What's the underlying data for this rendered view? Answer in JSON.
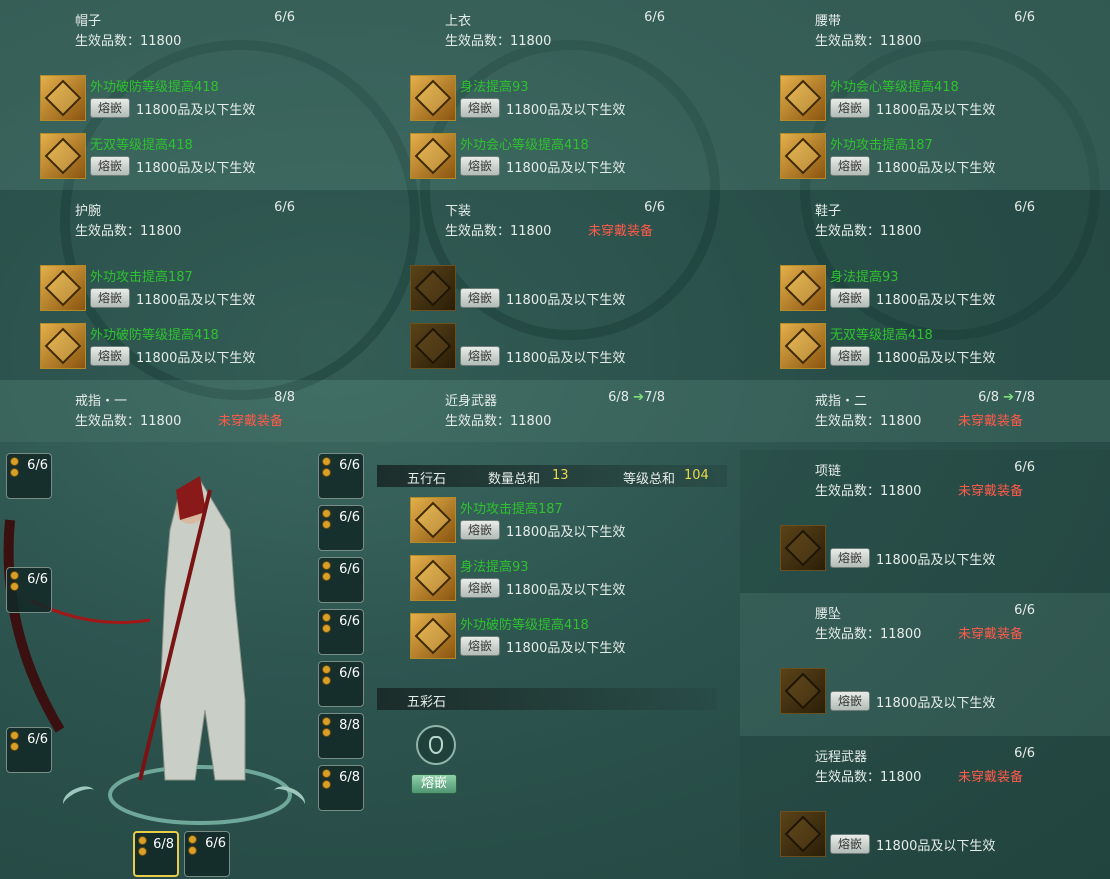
{
  "inlay_label": "熔嵌",
  "quality_label": "生效品数：",
  "unworn_label": "未穿戴装备",
  "slots": [
    {
      "name": "帽子",
      "count": "6/6",
      "quality": "11800",
      "gems": [
        {
          "attr": "外功破防等级提高418",
          "desc": "11800品及以下生效"
        },
        {
          "attr": "无双等级提高418",
          "desc": "11800品及以下生效"
        }
      ]
    },
    {
      "name": "上衣",
      "count": "6/6",
      "quality": "11800",
      "gems": [
        {
          "attr": "身法提高93",
          "desc": "11800品及以下生效"
        },
        {
          "attr": "外功会心等级提高418",
          "desc": "11800品及以下生效"
        }
      ]
    },
    {
      "name": "腰带",
      "count": "6/6",
      "quality": "11800",
      "gems": [
        {
          "attr": "外功会心等级提高418",
          "desc": "11800品及以下生效"
        },
        {
          "attr": "外功攻击提高187",
          "desc": "11800品及以下生效"
        }
      ]
    },
    {
      "name": "护腕",
      "count": "6/6",
      "quality": "11800",
      "gems": [
        {
          "attr": "外功攻击提高187",
          "desc": "11800品及以下生效"
        },
        {
          "attr": "外功破防等级提高418",
          "desc": "11800品及以下生效"
        }
      ]
    },
    {
      "name": "下装",
      "count": "6/6",
      "quality": "11800",
      "unworn": true,
      "gems": [
        {
          "attr": "",
          "desc": "11800品及以下生效"
        },
        {
          "attr": "",
          "desc": "11800品及以下生效"
        }
      ]
    },
    {
      "name": "鞋子",
      "count": "6/6",
      "quality": "11800",
      "gems": [
        {
          "attr": "身法提高93",
          "desc": "11800品及以下生效"
        },
        {
          "attr": "无双等级提高418",
          "desc": "11800品及以下生效"
        }
      ]
    },
    {
      "name": "戒指・一",
      "count": "8/8",
      "quality": "11800",
      "unworn": true
    },
    {
      "name": "近身武器",
      "count": "6/8",
      "count_up": "7/8",
      "quality": "11800"
    },
    {
      "name": "戒指・二",
      "count": "6/8",
      "count_up": "7/8",
      "quality": "11800",
      "unworn": true
    }
  ],
  "right_slots": [
    {
      "name": "项链",
      "count": "6/6",
      "quality": "11800",
      "desc": "11800品及以下生效"
    },
    {
      "name": "腰坠",
      "count": "6/6",
      "quality": "11800",
      "desc": "11800品及以下生效"
    },
    {
      "name": "远程武器",
      "count": "6/6",
      "quality": "11800",
      "desc": "11800品及以下生效"
    }
  ],
  "wuxing": {
    "title": "五行石",
    "qty_label": "数量总和",
    "qty": "13",
    "level_label": "等级总和",
    "level": "104",
    "gems": [
      {
        "attr": "外功攻击提高187",
        "desc": "11800品及以下生效"
      },
      {
        "attr": "身法提高93",
        "desc": "11800品及以下生效"
      },
      {
        "attr": "外功破防等级提高418",
        "desc": "11800品及以下生效"
      }
    ]
  },
  "wucai": {
    "title": "五彩石",
    "button": "熔嵌"
  },
  "side_left": [
    "6/6",
    "6/6",
    "6/6"
  ],
  "side_right": [
    "6/6",
    "6/6",
    "6/6",
    "6/6",
    "6/6",
    "8/8",
    "6/8"
  ],
  "bottom_slots": [
    "6/8",
    "6/6"
  ],
  "colors": {
    "gem_attr": "#2ec22e",
    "unworn": "#ff5a4a",
    "upgrade_arrow": "#7fe07a",
    "highlight": "#e8d84a"
  }
}
